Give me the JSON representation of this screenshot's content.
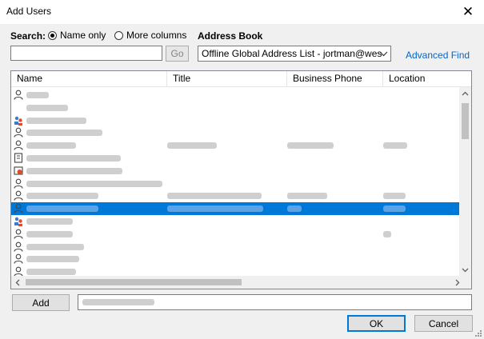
{
  "window": {
    "title": "Add Users",
    "close_glyph": "✕"
  },
  "search": {
    "label": "Search:",
    "options": [
      {
        "label": "Name only",
        "selected": true
      },
      {
        "label": "More columns",
        "selected": false
      }
    ],
    "input_value": "",
    "go_label": "Go"
  },
  "address_book": {
    "label": "Address Book",
    "selected": "Offline Global Address List - jortman@wes",
    "dropdown_icon": "chevron-down-icon",
    "advanced_find_label": "Advanced Find"
  },
  "list": {
    "columns": [
      "Name",
      "Title",
      "Business Phone",
      "Location"
    ],
    "selected_row_index": 9,
    "rows": [
      {
        "icon": "user-icon",
        "name_w": 28,
        "title_w": 0,
        "phone_w": 0,
        "loc_w": 0
      },
      {
        "icon": "none",
        "name_w": 52,
        "title_w": 0,
        "phone_w": 0,
        "loc_w": 0
      },
      {
        "icon": "group-icon",
        "name_w": 75,
        "title_w": 0,
        "phone_w": 0,
        "loc_w": 0
      },
      {
        "icon": "user-icon",
        "name_w": 95,
        "title_w": 0,
        "phone_w": 0,
        "loc_w": 0
      },
      {
        "icon": "user-icon",
        "name_w": 62,
        "title_w": 62,
        "phone_w": 58,
        "loc_w": 30
      },
      {
        "icon": "contact-icon",
        "name_w": 118,
        "title_w": 0,
        "phone_w": 0,
        "loc_w": 0
      },
      {
        "icon": "restricted-group-icon",
        "name_w": 120,
        "title_w": 0,
        "phone_w": 0,
        "loc_w": 0
      },
      {
        "icon": "user-icon",
        "name_w": 170,
        "title_w": 0,
        "phone_w": 0,
        "loc_w": 0
      },
      {
        "icon": "user-icon",
        "name_w": 90,
        "title_w": 118,
        "phone_w": 50,
        "loc_w": 28
      },
      {
        "icon": "user-icon",
        "name_w": 90,
        "title_w": 120,
        "phone_w": 18,
        "loc_w": 28
      },
      {
        "icon": "group-icon",
        "name_w": 58,
        "title_w": 0,
        "phone_w": 0,
        "loc_w": 0
      },
      {
        "icon": "user-icon",
        "name_w": 58,
        "title_w": 0,
        "phone_w": 0,
        "loc_w": 10
      },
      {
        "icon": "user-icon",
        "name_w": 72,
        "title_w": 0,
        "phone_w": 0,
        "loc_w": 0
      },
      {
        "icon": "user-icon",
        "name_w": 66,
        "title_w": 0,
        "phone_w": 0,
        "loc_w": 0
      },
      {
        "icon": "user-icon",
        "name_w": 62,
        "title_w": 0,
        "phone_w": 0,
        "loc_w": 0
      }
    ]
  },
  "footer": {
    "add_label": "Add",
    "add_value": "",
    "ok_label": "OK",
    "cancel_label": "Cancel"
  },
  "colors": {
    "selection": "#0078d7",
    "link": "#0066cc"
  }
}
